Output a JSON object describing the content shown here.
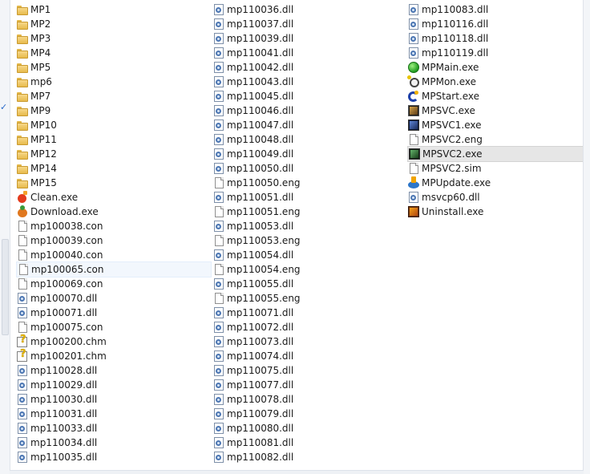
{
  "columns": [
    {
      "items": [
        {
          "name": "MP1",
          "icon": "folder-icon"
        },
        {
          "name": "MP2",
          "icon": "folder-icon"
        },
        {
          "name": "MP3",
          "icon": "folder-icon"
        },
        {
          "name": "MP4",
          "icon": "folder-icon"
        },
        {
          "name": "MP5",
          "icon": "folder-icon"
        },
        {
          "name": "mp6",
          "icon": "folder-icon"
        },
        {
          "name": "MP7",
          "icon": "folder-icon"
        },
        {
          "name": "MP9",
          "icon": "folder-icon"
        },
        {
          "name": "MP10",
          "icon": "folder-icon"
        },
        {
          "name": "MP11",
          "icon": "folder-icon"
        },
        {
          "name": "MP12",
          "icon": "folder-icon"
        },
        {
          "name": "MP14",
          "icon": "folder-icon"
        },
        {
          "name": "MP15",
          "icon": "folder-icon"
        },
        {
          "name": "Clean.exe",
          "icon": "clean-app-icon"
        },
        {
          "name": "Download.exe",
          "icon": "download-app-icon"
        },
        {
          "name": "mp100038.con",
          "icon": "document-icon"
        },
        {
          "name": "mp100039.con",
          "icon": "document-icon"
        },
        {
          "name": "mp100040.con",
          "icon": "document-icon"
        },
        {
          "name": "mp100065.con",
          "icon": "document-icon",
          "state": "hover"
        },
        {
          "name": "mp100069.con",
          "icon": "document-icon"
        },
        {
          "name": "mp100070.dll",
          "icon": "dll-file-icon"
        },
        {
          "name": "mp100071.dll",
          "icon": "dll-file-icon"
        },
        {
          "name": "mp100075.con",
          "icon": "document-icon"
        },
        {
          "name": "mp100200.chm",
          "icon": "help-file-icon"
        },
        {
          "name": "mp100201.chm",
          "icon": "help-file-icon"
        },
        {
          "name": "mp110028.dll",
          "icon": "dll-file-icon"
        },
        {
          "name": "mp110029.dll",
          "icon": "dll-file-icon"
        },
        {
          "name": "mp110030.dll",
          "icon": "dll-file-icon"
        },
        {
          "name": "mp110031.dll",
          "icon": "dll-file-icon"
        },
        {
          "name": "mp110033.dll",
          "icon": "dll-file-icon"
        },
        {
          "name": "mp110034.dll",
          "icon": "dll-file-icon"
        },
        {
          "name": "mp110035.dll",
          "icon": "dll-file-icon"
        }
      ]
    },
    {
      "items": [
        {
          "name": "mp110036.dll",
          "icon": "dll-file-icon"
        },
        {
          "name": "mp110037.dll",
          "icon": "dll-file-icon"
        },
        {
          "name": "mp110039.dll",
          "icon": "dll-file-icon"
        },
        {
          "name": "mp110041.dll",
          "icon": "dll-file-icon"
        },
        {
          "name": "mp110042.dll",
          "icon": "dll-file-icon"
        },
        {
          "name": "mp110043.dll",
          "icon": "dll-file-icon"
        },
        {
          "name": "mp110045.dll",
          "icon": "dll-file-icon"
        },
        {
          "name": "mp110046.dll",
          "icon": "dll-file-icon"
        },
        {
          "name": "mp110047.dll",
          "icon": "dll-file-icon"
        },
        {
          "name": "mp110048.dll",
          "icon": "dll-file-icon"
        },
        {
          "name": "mp110049.dll",
          "icon": "dll-file-icon"
        },
        {
          "name": "mp110050.dll",
          "icon": "dll-file-icon"
        },
        {
          "name": "mp110050.eng",
          "icon": "document-icon"
        },
        {
          "name": "mp110051.dll",
          "icon": "dll-file-icon"
        },
        {
          "name": "mp110051.eng",
          "icon": "document-icon"
        },
        {
          "name": "mp110053.dll",
          "icon": "dll-file-icon"
        },
        {
          "name": "mp110053.eng",
          "icon": "document-icon"
        },
        {
          "name": "mp110054.dll",
          "icon": "dll-file-icon"
        },
        {
          "name": "mp110054.eng",
          "icon": "document-icon"
        },
        {
          "name": "mp110055.dll",
          "icon": "dll-file-icon"
        },
        {
          "name": "mp110055.eng",
          "icon": "document-icon"
        },
        {
          "name": "mp110071.dll",
          "icon": "dll-file-icon"
        },
        {
          "name": "mp110072.dll",
          "icon": "dll-file-icon"
        },
        {
          "name": "mp110073.dll",
          "icon": "dll-file-icon"
        },
        {
          "name": "mp110074.dll",
          "icon": "dll-file-icon"
        },
        {
          "name": "mp110075.dll",
          "icon": "dll-file-icon"
        },
        {
          "name": "mp110077.dll",
          "icon": "dll-file-icon"
        },
        {
          "name": "mp110078.dll",
          "icon": "dll-file-icon"
        },
        {
          "name": "mp110079.dll",
          "icon": "dll-file-icon"
        },
        {
          "name": "mp110080.dll",
          "icon": "dll-file-icon"
        },
        {
          "name": "mp110081.dll",
          "icon": "dll-file-icon"
        },
        {
          "name": "mp110082.dll",
          "icon": "dll-file-icon"
        }
      ]
    },
    {
      "items": [
        {
          "name": "mp110083.dll",
          "icon": "dll-file-icon"
        },
        {
          "name": "mp110116.dll",
          "icon": "dll-file-icon"
        },
        {
          "name": "mp110118.dll",
          "icon": "dll-file-icon"
        },
        {
          "name": "mp110119.dll",
          "icon": "dll-file-icon"
        },
        {
          "name": "MPMain.exe",
          "icon": "mpmain-app-icon"
        },
        {
          "name": "MPMon.exe",
          "icon": "mpmon-app-icon"
        },
        {
          "name": "MPStart.exe",
          "icon": "mpstart-app-icon"
        },
        {
          "name": "MPSVC.exe",
          "icon": "mpsvc-app-icon"
        },
        {
          "name": "MPSVC1.exe",
          "icon": "mpsvc1-app-icon"
        },
        {
          "name": "MPSVC2.eng",
          "icon": "document-icon"
        },
        {
          "name": "MPSVC2.exe",
          "icon": "mpsvc2-app-icon",
          "state": "selected"
        },
        {
          "name": "MPSVC2.sim",
          "icon": "document-icon"
        },
        {
          "name": "MPUpdate.exe",
          "icon": "mpupdate-app-icon"
        },
        {
          "name": "msvcp60.dll",
          "icon": "dll-file-icon"
        },
        {
          "name": "Uninstall.exe",
          "icon": "uninstall-app-icon"
        }
      ]
    }
  ],
  "colors": {
    "hover_bg": "#f2f7fd",
    "selected_bg": "#e6e6e6",
    "text": "#1a1a1a"
  }
}
